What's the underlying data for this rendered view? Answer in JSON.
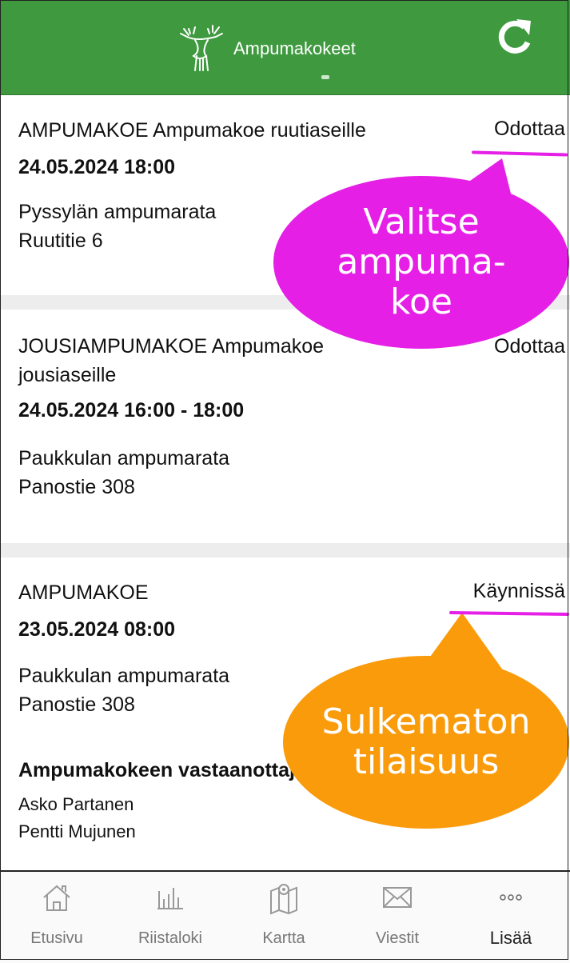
{
  "header": {
    "title": "Ampumakokeet",
    "bg_color": "#3f9a3f"
  },
  "events": [
    {
      "title": "AMPUMAKOE Ampumakoe ruutiaseille",
      "status": "Odottaa",
      "datetime": "24.05.2024 18:00",
      "place_name": "Pyssylän ampumarata",
      "place_address": "Ruutitie 6"
    },
    {
      "title_line1": "JOUSIAMPUMAKOE Ampumakoe",
      "title_line2": "jousiaseille",
      "status": "Odottaa",
      "datetime": "24.05.2024 16:00 - 18:00",
      "place_name": "Paukkulan ampumarata",
      "place_address": "Panostie 308"
    },
    {
      "title": "AMPUMAKOE",
      "status": "Käynnissä",
      "datetime": "23.05.2024 08:00",
      "place_name": "Paukkulan ampumarata",
      "place_address": "Panostie 308",
      "receivers_heading": "Ampumakokeen vastaanottajat",
      "receivers": [
        "Asko Partanen",
        "Pentti Mujunen"
      ]
    }
  ],
  "callouts": {
    "select": {
      "line1": "Valitse",
      "line2": "ampuma-",
      "line3": "koe",
      "color": "#e61fe6"
    },
    "open": {
      "line1": "Sulkematon",
      "line2": "tilaisuus",
      "color": "#f99b0b"
    }
  },
  "bottom_nav": [
    {
      "label": "Etusivu",
      "icon": "home-icon"
    },
    {
      "label": "Riistaloki",
      "icon": "chart-icon"
    },
    {
      "label": "Kartta",
      "icon": "map-icon"
    },
    {
      "label": "Viestit",
      "icon": "mail-icon"
    },
    {
      "label": "Lisää",
      "icon": "more-icon",
      "active": true
    }
  ]
}
